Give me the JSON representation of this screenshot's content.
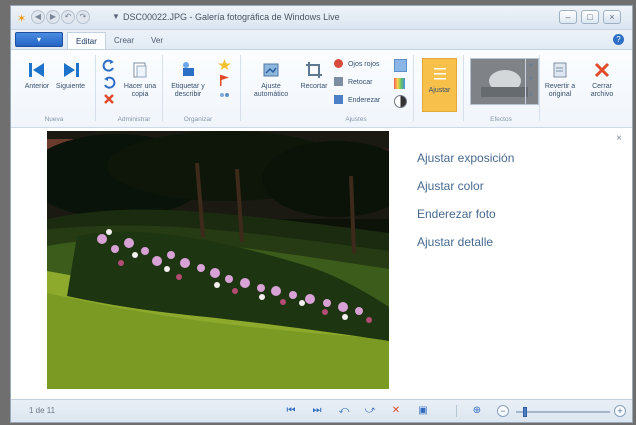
{
  "window": {
    "title": "DSC00022.JPG - Galería fotográfica de Windows Live"
  },
  "tabs": {
    "app_menu": "▾",
    "items": [
      "Editar",
      "Crear",
      "Ver"
    ]
  },
  "ribbon": {
    "buttons": {
      "anterior": "Anterior",
      "siguiente": "Siguiente",
      "hacer_copia": "Hacer una copia",
      "etiquetar": "Etiquetar y describir",
      "ajuste_auto": "Ajuste automático",
      "recortar": "Recortar",
      "ojos_rojos": "Ojos rojos",
      "retocar": "Retocar",
      "enderezar": "Enderezar",
      "ajustar": "Ajustar",
      "revertir": "Revertir a original",
      "cerrar": "Cerrar archivo"
    },
    "groups": {
      "nueva": "Nueva",
      "administrar": "Administrar",
      "organizar": "Organizar",
      "ajustes": "Ajustes",
      "efectos": "Efectos"
    }
  },
  "panel": {
    "close": "×",
    "links": [
      "Ajustar exposición",
      "Ajustar color",
      "Enderezar foto",
      "Ajustar detalle"
    ]
  },
  "status": {
    "counter": "1 de 11",
    "zoom_fraction": 0.08
  },
  "colors": {
    "accent": "#2d6fc6",
    "close_red": "#e04b2b",
    "selected_ribbon": "#f7c04a"
  }
}
